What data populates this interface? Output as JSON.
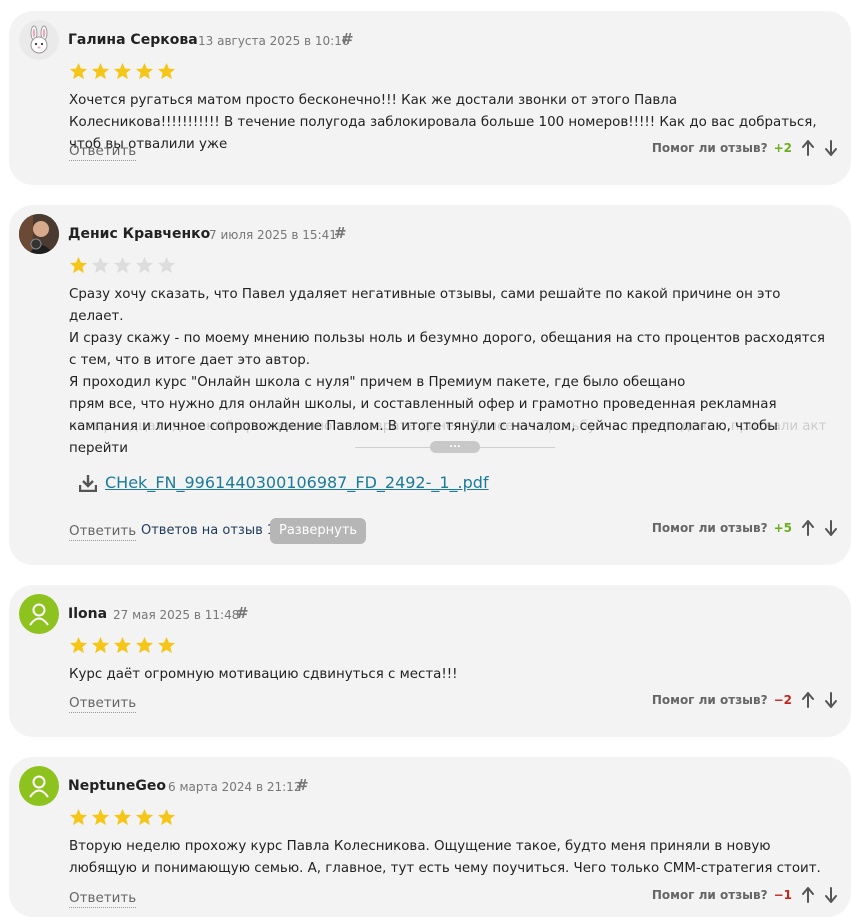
{
  "reviews": [
    {
      "author": "Галина Серкова",
      "date": "13 августа 2025 в 10:16",
      "hash": "#",
      "rating": 5,
      "avatar": "bunny",
      "paragraphs": [
        "Хочется ругаться матом просто бесконечно!!! Как же достали звонки от этого Павла Колесникова!!!!!!!!!!! В течение полугода заблокировала больше 100 номеров!!!!! Как до вас добраться, чтоб вы отвалили уже"
      ],
      "reply_label": "Ответить",
      "helpful_label": "Помог ли отзыв?",
      "score": "+2"
    },
    {
      "author": "Денис Кравченко",
      "date": "7 июля 2025 в 15:41",
      "hash": "#",
      "rating": 1,
      "avatar": "photo",
      "paragraphs": [
        "Сразу хочу сказать, что Павел удаляет негативные отзывы, сами решайте по какой причине он это делает.",
        "И сразу скажу - по моему мнению пользы ноль и безумно дорого, обещания на сто процентов расходятся с тем, что в итоге дает это автор.",
        "Я проходил курс \"Онлайн школа с нуля\" причем в Премиум пакете, где было обещано",
        "прям все, что нужно для онлайн школы, и составленный офер и грамотно проведенная рекламная кампания и личное сопровождение Павлом. В итоге тянули с началом, сейчас предполагаю, чтобы перейти"
      ],
      "faded_text": "четырнадцатидневный срок законного возврата денег. Далее на просьбу о возврате денег, прислали акт",
      "more_label": "...",
      "attachment": "CHek_FN_9961440300106987_FD_2492-_1_.pdf",
      "reply_label": "Ответить",
      "replies_label": "Ответов на отзыв 1",
      "expand_label": "Развернуть",
      "helpful_label": "Помог ли отзыв?",
      "score": "+5"
    },
    {
      "author": "Ilona",
      "date": "27 мая 2025 в 11:48",
      "hash": "#",
      "rating": 5,
      "avatar": "default",
      "paragraphs": [
        "Курс даёт огромную мотивацию сдвинуться с места!!!"
      ],
      "reply_label": "Ответить",
      "helpful_label": "Помог ли отзыв?",
      "score": "−2"
    },
    {
      "author": "NeptuneGeo",
      "date": "6 марта 2024 в 21:12",
      "hash": "#",
      "rating": 5,
      "avatar": "default",
      "paragraphs": [
        "Вторую неделю прохожу курс Павла Колесникова. Ощущение такое, будто меня приняли в новую любящую и понимающую семью. А, главное, тут есть чему поучиться. Чего только СММ-стратегия стоит."
      ],
      "reply_label": "Ответить",
      "helpful_label": "Помог ли отзыв?",
      "score": "−1"
    }
  ],
  "colors": {
    "star_on": "#f5c518",
    "star_off": "#dddddd",
    "positive": "#6cae1e",
    "negative": "#c0261b",
    "link": "#1d7b9a"
  }
}
